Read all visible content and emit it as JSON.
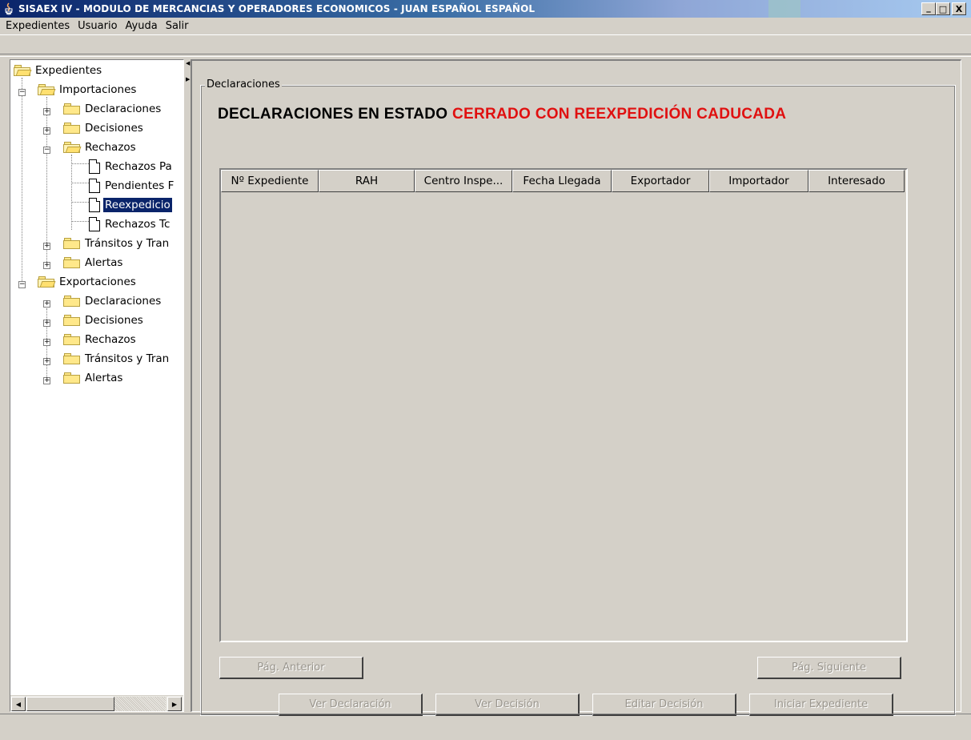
{
  "window": {
    "title": "SISAEX IV - MODULO DE MERCANCIAS Y OPERADORES ECONOMICOS - JUAN ESPAÑOL ESPAÑOL",
    "minimize": "_",
    "maximize": "□",
    "close": "X"
  },
  "menu": [
    "Expedientes",
    "Usuario",
    "Ayuda",
    "Salir"
  ],
  "tree": {
    "root": "Expedientes",
    "import_group": "Importaciones",
    "import_items": {
      "declaraciones": "Declaraciones",
      "decisiones": "Decisiones",
      "rechazos": "Rechazos",
      "rechazos_children": [
        "Rechazos Pa",
        "Pendientes F",
        "Reexpedicio",
        "Rechazos Tc"
      ],
      "transitos": "Tránsitos y Tran",
      "alertas": "Alertas"
    },
    "export_group": "Exportaciones",
    "export_items": [
      "Declaraciones",
      "Decisiones",
      "Rechazos",
      "Tránsitos y Tran",
      "Alertas"
    ],
    "selected": "Reexpedicio"
  },
  "panel": {
    "group_title": "Declaraciones",
    "heading_prefix": "DECLARACIONES EN ESTADO",
    "heading_status": "CERRADO CON REEXPEDICIÓN CADUCADA",
    "heading_status_color": "#e01010"
  },
  "table": {
    "columns": [
      "Nº Expediente",
      "RAH",
      "Centro Inspe...",
      "Fecha Llegada",
      "Exportador",
      "Importador",
      "Interesado"
    ],
    "rows": []
  },
  "buttons": {
    "prev_page": "Pág. Anterior",
    "next_page": "Pág. Siguiente",
    "view_declaration": "Ver Declaración",
    "view_decision": "Ver Decisión",
    "edit_decision": "Editar Decisión",
    "start_file": "Iniciar Expediente"
  }
}
